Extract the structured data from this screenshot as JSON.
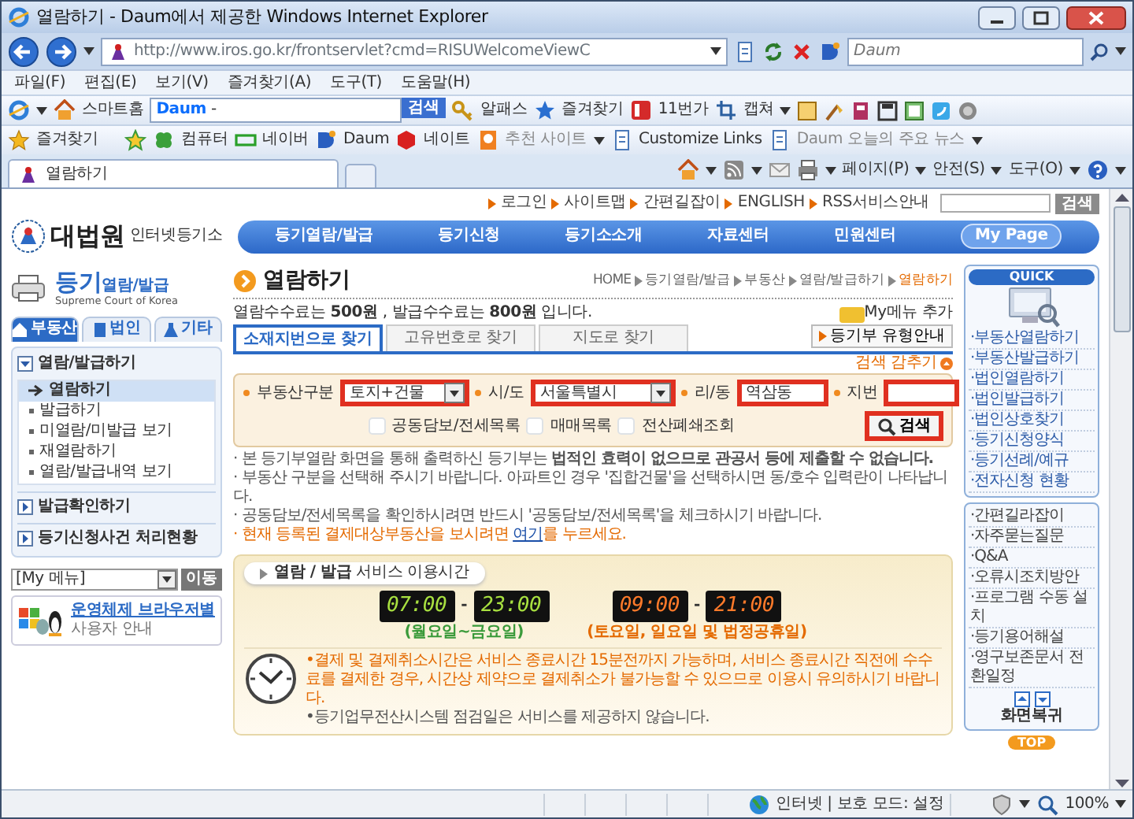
{
  "window": {
    "title": "열람하기 - Daum에서 제공한 Windows Internet Explorer"
  },
  "address_bar": {
    "url": "http://www.iros.go.kr/frontservlet?cmd=RISUWelcomeViewC",
    "search_placeholder": "Daum"
  },
  "menu_bar": [
    "파일(F)",
    "편집(E)",
    "보기(V)",
    "즐겨찾기(A)",
    "도구(T)",
    "도움말(H)"
  ],
  "daum_toolbar": {
    "home": "스마트홈",
    "search_logo": "Daum",
    "search_value": "-",
    "search_button": "검색",
    "items": [
      "알패스",
      "즐겨찾기",
      "11번가",
      "캡쳐"
    ]
  },
  "favorites_bar": {
    "label": "즐겨찾기",
    "links": [
      {
        "label": "컴퓨터",
        "disabled": false,
        "dropdown": false
      },
      {
        "label": "네이버",
        "disabled": false,
        "dropdown": false
      },
      {
        "label": "Daum",
        "disabled": false,
        "dropdown": false
      },
      {
        "label": "네이트",
        "disabled": false,
        "dropdown": false
      },
      {
        "label": "추천 사이트",
        "disabled": true,
        "dropdown": true
      },
      {
        "label": "Customize Links",
        "disabled": false,
        "dropdown": false
      },
      {
        "label": "Daum 오늘의 주요 뉴스",
        "disabled": true,
        "dropdown": true
      }
    ]
  },
  "browser_tabs": [
    {
      "label": "열람하기",
      "selected": true
    }
  ],
  "command_bar": [
    "페이지(P)",
    "안전(S)",
    "도구(O)"
  ],
  "page": {
    "top_links": [
      "로그인",
      "사이트맵",
      "간편길잡이",
      "ENGLISH",
      "RSS서비스안내"
    ],
    "top_search_button": "검색",
    "logo": {
      "title": "대법원",
      "subtitle": "인터넷등기소"
    },
    "nav": [
      {
        "label": "등기열람/발급",
        "kind": "menu"
      },
      {
        "label": "등기신청",
        "kind": "menu"
      },
      {
        "label": "등기소소개",
        "kind": "menu"
      },
      {
        "label": "자료센터",
        "kind": "menu"
      },
      {
        "label": "민원센터",
        "kind": "menu"
      },
      {
        "label": "My Page",
        "kind": "pill"
      }
    ],
    "sidebar": {
      "title_main": "등기",
      "title_sub": "열람/발급",
      "subtitle": "Supreme Court of Korea",
      "tabs": [
        {
          "label": "부동산",
          "selected": true
        },
        {
          "label": "법인",
          "selected": false
        },
        {
          "label": "기타",
          "selected": false
        }
      ],
      "menu": [
        {
          "label": "열람/발급하기",
          "expanded": true,
          "children": [
            {
              "label": "열람하기",
              "selected": true
            },
            {
              "label": "발급하기",
              "selected": false
            },
            {
              "label": "미열람/미발급 보기",
              "selected": false
            },
            {
              "label": "재열람하기",
              "selected": false
            },
            {
              "label": "열람/발급내역 보기",
              "selected": false
            }
          ]
        },
        {
          "label": "발급확인하기",
          "expanded": false
        },
        {
          "label": "등기신청사건 처리현황",
          "expanded": false
        }
      ],
      "my_menu": {
        "value": "[My 메뉴]",
        "button": "이동"
      },
      "guide": {
        "title": "운영체제 브라우저별",
        "subtitle": "사용자 안내"
      }
    },
    "main": {
      "title": "열람하기",
      "breadcrumb": [
        "HOME",
        "등기열람/발급",
        "부동산",
        "열람/발급하기",
        "열람하기"
      ],
      "fee_note": "열람수수료는 **500원** , 발급수수료는 **800원** 입니다.",
      "my_menu_add": "My메뉴 추가",
      "tabs": [
        {
          "label": "소재지번으로 찾기",
          "selected": true
        },
        {
          "label": "고유번호로 찾기",
          "selected": false
        },
        {
          "label": "지도로 찾기",
          "selected": false
        }
      ],
      "type_guide_button": "등기부 유형안내",
      "hide_search": "검색 감추기",
      "search_form": {
        "fields": [
          {
            "label": "부동산구분",
            "kind": "select",
            "value": "토지+건물",
            "highlighted": true
          },
          {
            "label": "시/도",
            "kind": "select",
            "value": "서울특별시",
            "highlighted": true
          },
          {
            "label": "리/동",
            "kind": "input",
            "value": "역삼동",
            "highlighted": true
          },
          {
            "label": "지번",
            "kind": "input",
            "highlighted": true
          }
        ],
        "options": [
          {
            "label": "공동담보/전세목록",
            "checked": false
          },
          {
            "label": "매매목록",
            "checked": false
          },
          {
            "label": "전산폐쇄조회",
            "checked": false
          }
        ],
        "search_button": {
          "label": "검색",
          "highlighted": true
        }
      },
      "notes": [
        {
          "kind": "plain",
          "text": "· 본 등기부열람 화면을 통해 출력하신 등기부는 **법적인 효력이 없으므로 관공서 등에 제출할 수 없습니다.**"
        },
        {
          "kind": "plain",
          "text": "· 부동산 구분을 선택해 주시기 바랍니다. 아파트인 경우 '집합건물'을 선택하시면 동/호수 입력란이 나타납니다."
        },
        {
          "kind": "plain",
          "text": "· 공동담보/전세목록을 확인하시려면 반드시 '공동담보/전세목록'을 체크하시기 바랍니다."
        },
        {
          "kind": "alert",
          "text": "· 현재 등록된 결제대상부동산을 보시려면 ",
          "link": "여기",
          "text_after": "를 누르세요."
        }
      ],
      "service_hours": {
        "title": "**열람 / 발급** 서비스 이용시간",
        "slots": [
          {
            "kind": "weekday",
            "start": "07:00",
            "separator": "-",
            "end": "23:00",
            "days": "(월요일~금요일)"
          },
          {
            "kind": "weekend",
            "start": "09:00",
            "separator": "-",
            "end": "21:00",
            "days": "(토요일, 일요일 및 법정공휴일)"
          }
        ],
        "notes": [
          {
            "kind": "alert",
            "text": "•결제 및 결제취소시간은 서비스 종료시간 15분전까지 가능하며, 서비스 종료시간 직전에 수수료를 결제한 경우, 시간상 제약으로 결제취소가 불가능할 수 있으므로 이용시 유의하시기 바랍니다."
          },
          {
            "kind": "plain",
            "text": "•등기업무전산시스템 점검일은 서비스를 제공하지 않습니다."
          }
        ]
      }
    },
    "quick_menu": {
      "title": "QUICK",
      "items": [
        "·부동산열람하기",
        "·부동산발급하기",
        "·법인열람하기",
        "·법인발급하기",
        "·법인상호찾기",
        "·등기신청양식",
        "·등기선례/예규",
        "·전자신청 현황"
      ],
      "items2": [
        "·간편길라잡이",
        "·자주묻는질문",
        "·Q&A",
        "·오류시조치방안",
        "·프로그램 수동 설치",
        "·등기용어해설",
        "·영구보존문서 전환일정"
      ],
      "restore": "화면복귀",
      "top": "TOP"
    }
  },
  "status_bar": {
    "zone": "인터넷 | 보호 모드: 설정",
    "zoom": "100%"
  }
}
